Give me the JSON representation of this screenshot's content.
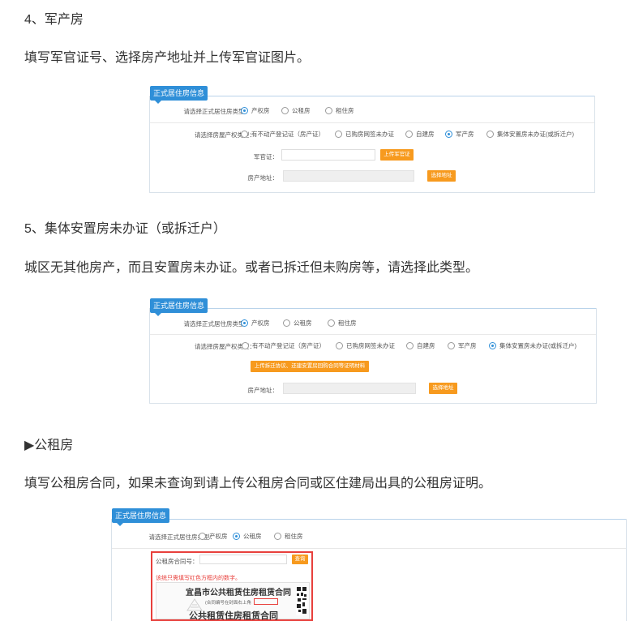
{
  "sections": {
    "s4": {
      "heading": "4、军产房",
      "desc": "填写军官证号、选择房产地址并上传军官证图片。"
    },
    "s5": {
      "heading": "5、集体安置房未办证（或拆迁户）",
      "desc": "城区无其他房产，而且安置房未办证。或者已拆迁但未购房等，请选择此类型。"
    },
    "s6": {
      "heading": "▶公租房",
      "desc": "填写公租房合同，如果未查询到请上传公租房合同或区住建局出具的公租房证明。"
    }
  },
  "form": {
    "tag": "正式居住房信息",
    "house_type_label": "请选择正式居住房类型：",
    "house_types": [
      "产权房",
      "公租房",
      "租住房"
    ],
    "property_type_label": "请选择房屋产权类型：",
    "property_types": [
      "有不动产登记证（房产证）",
      "已购房网签未办证",
      "自建房",
      "军产房",
      "集体安置房未办证(或拆迁户)"
    ],
    "officer_label": "军官证：",
    "upload_officer_btn": "上传军官证",
    "address_label": "房产地址：",
    "select_address_btn": "选择地址",
    "upload_demolition_btn": "上传拆迁协议、还建安置房回购合同等证明材料",
    "rental_contract_label": "公租房合同号：",
    "query_btn": "查询",
    "red_hint": "该统只需填写红色方框内的数字。",
    "contract_city_title": "宜昌市公共租赁住房租赁合同",
    "contract_main_title": "公共租赁住房租赁合同",
    "contract_number_hint": "(合同编号在封面右上角"
  },
  "colors": {
    "accent": "#2f8fd8",
    "button": "#f79a1e",
    "highlight_box": "#e8403c"
  }
}
